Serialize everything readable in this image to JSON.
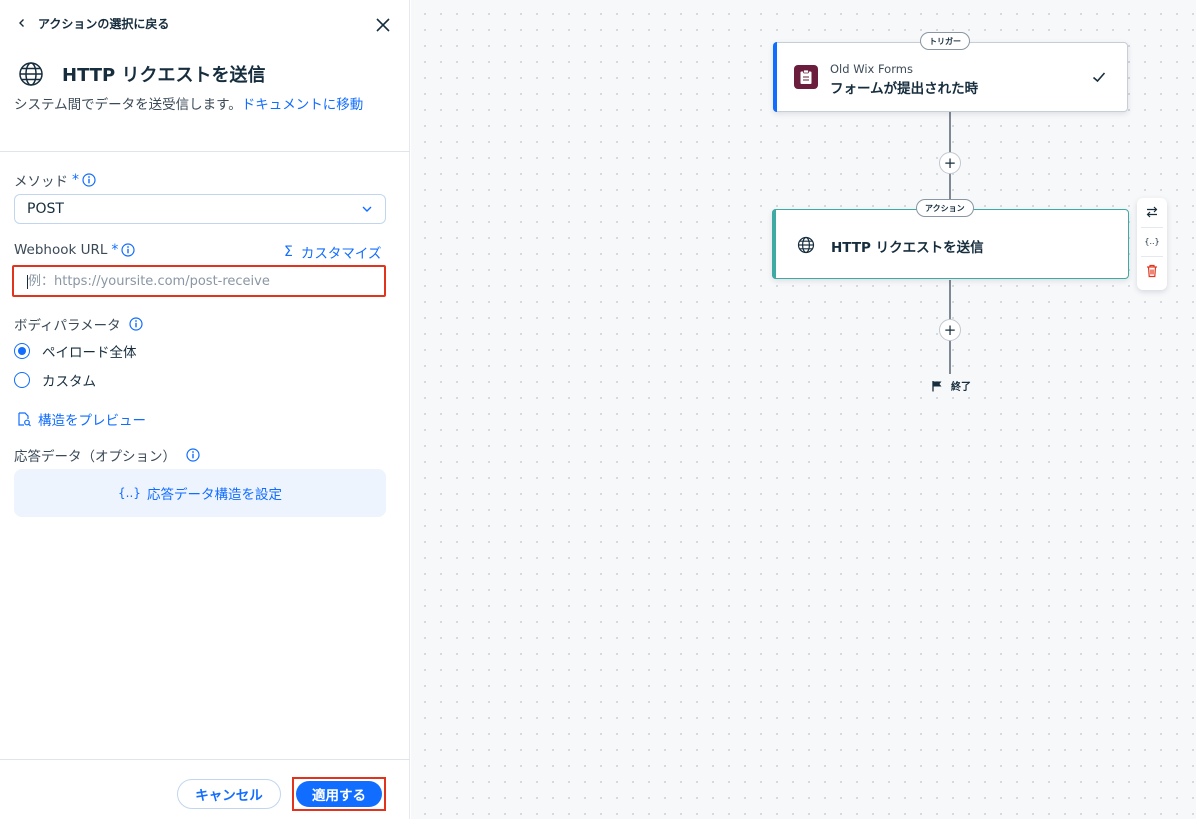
{
  "panel": {
    "back_label": "アクションの選択に戻る",
    "title": "HTTP リクエストを送信",
    "description": "システム間でデータを送受信します。",
    "doc_link": "ドキュメントに移動",
    "method": {
      "label": "メソッド",
      "required_mark": "*",
      "value": "POST"
    },
    "webhook": {
      "label": "Webhook URL",
      "required_mark": "*",
      "placeholder": "例：https://yoursite.com/post-receive",
      "value": "",
      "customize_icon": "Σ",
      "customize_label": "カスタマイズ"
    },
    "body_params": {
      "label": "ボディパラメータ",
      "options": [
        {
          "label": "ペイロード全体",
          "selected": true
        },
        {
          "label": "カスタム",
          "selected": false
        }
      ]
    },
    "preview_label": "構造をプレビュー",
    "response": {
      "label": "応答データ（オプション）",
      "curly_icon": "{..}",
      "button_label": "応答データ構造を設定"
    },
    "footer": {
      "cancel_label": "キャンセル",
      "apply_label": "適用する"
    }
  },
  "flow": {
    "trigger": {
      "pill": "トリガー",
      "app_name": "Old Wix Forms",
      "event": "フォームが提出された時",
      "accent_color": "#116dff"
    },
    "action": {
      "pill": "アクション",
      "title": "HTTP リクエストを送信",
      "accent_color": "#3fa9a3"
    },
    "toolbar": {
      "curly_icon": "{..}"
    },
    "add_symbol": "+",
    "end_label": "終了"
  },
  "colors": {
    "primary": "#116dff",
    "highlight": "#e2341d",
    "delete": "#e2341d"
  }
}
